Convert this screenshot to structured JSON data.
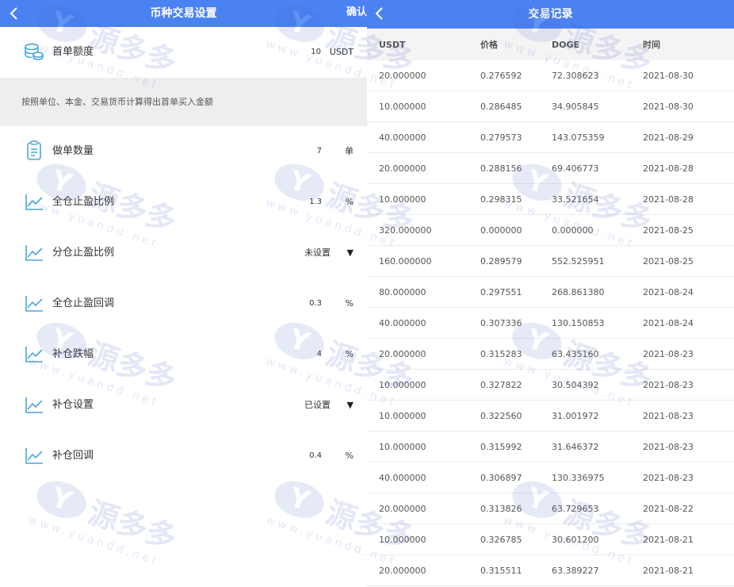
{
  "left": {
    "nav": {
      "title": "币种交易设置",
      "confirm": "确认"
    },
    "first_order": {
      "label": "首单额度",
      "value": "10",
      "unit": "USDT"
    },
    "note": "按照单位、本金、交易货币计算得出首单买入金额",
    "rows": [
      {
        "label": "做单数量",
        "value": "7",
        "unit": "单",
        "icon": "clipboard-icon"
      },
      {
        "label": "全仓止盈比例",
        "value": "1.3",
        "unit": "%",
        "icon": "line-chart-icon"
      },
      {
        "label": "分仓止盈比例",
        "value": "未设置",
        "arrow": "▼",
        "icon": "line-chart-icon"
      },
      {
        "label": "全仓止盈回调",
        "value": "0.3",
        "unit": "%",
        "icon": "line-chart-icon"
      },
      {
        "label": "补仓跌幅",
        "value": "4",
        "unit": "%",
        "icon": "line-chart-icon"
      },
      {
        "label": "补仓设置",
        "value": "已设置",
        "arrow": "▼",
        "icon": "line-chart-icon"
      },
      {
        "label": "补仓回调",
        "value": "0.4",
        "unit": "%",
        "icon": "line-chart-icon"
      }
    ]
  },
  "right": {
    "nav": {
      "title": "交易记录"
    },
    "columns": [
      "USDT",
      "价格",
      "DOGE",
      "时间"
    ],
    "records": [
      [
        "20.000000",
        "0.276592",
        "72.308623",
        "2021-08-30"
      ],
      [
        "10.000000",
        "0.286485",
        "34.905845",
        "2021-08-30"
      ],
      [
        "40.000000",
        "0.279573",
        "143.075359",
        "2021-08-29"
      ],
      [
        "20.000000",
        "0.288156",
        "69.406773",
        "2021-08-28"
      ],
      [
        "10.000000",
        "0.298315",
        "33.521654",
        "2021-08-28"
      ],
      [
        "320.000000",
        "0.000000",
        "0.000000",
        "2021-08-25"
      ],
      [
        "160.000000",
        "0.289579",
        "552.525951",
        "2021-08-25"
      ],
      [
        "80.000000",
        "0.297551",
        "268.861380",
        "2021-08-24"
      ],
      [
        "40.000000",
        "0.307336",
        "130.150853",
        "2021-08-24"
      ],
      [
        "20.000000",
        "0.315283",
        "63.435160",
        "2021-08-23"
      ],
      [
        "10.000000",
        "0.327822",
        "30.504392",
        "2021-08-23"
      ],
      [
        "10.000000",
        "0.322560",
        "31.001972",
        "2021-08-23"
      ],
      [
        "10.000000",
        "0.315992",
        "31.646372",
        "2021-08-23"
      ],
      [
        "40.000000",
        "0.306897",
        "130.336975",
        "2021-08-23"
      ],
      [
        "20.000000",
        "0.313826",
        "63.729653",
        "2021-08-22"
      ],
      [
        "10.000000",
        "0.326785",
        "30.601200",
        "2021-08-21"
      ],
      [
        "20.000000",
        "0.315511",
        "63.389227",
        "2021-08-21"
      ]
    ]
  },
  "watermark": {
    "mark": "Y",
    "name": "源多多",
    "url": "www.yuandd.net"
  },
  "colors": {
    "navbar": "#4a82f2",
    "icon": "#4aa6d8"
  }
}
